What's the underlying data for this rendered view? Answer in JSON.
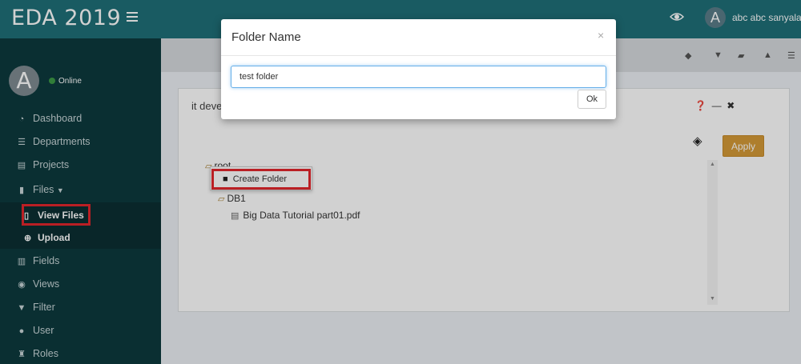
{
  "header": {
    "title": "EDA 2019",
    "username": "abc abc sanyala.",
    "avatar_letter": "A"
  },
  "sidebar": {
    "avatar_letter": "A",
    "status": "Online",
    "items": [
      {
        "label": "Dashboard",
        "icon": "dashboard-icon"
      },
      {
        "label": "Departments",
        "icon": "list-icon"
      },
      {
        "label": "Projects",
        "icon": "server-icon"
      },
      {
        "label": "Files",
        "icon": "file-icon"
      },
      {
        "label": "Fields",
        "icon": "list-alt-icon"
      },
      {
        "label": "Views",
        "icon": "view-icon"
      },
      {
        "label": "Filter",
        "icon": "filter-icon"
      },
      {
        "label": "User",
        "icon": "user-icon"
      },
      {
        "label": "Roles",
        "icon": "roles-icon"
      }
    ],
    "submenu": [
      {
        "label": "View Files",
        "icon": "file-icon"
      },
      {
        "label": "Upload",
        "icon": "upload-icon"
      }
    ]
  },
  "panel": {
    "title": "it deve",
    "apply_label": "Apply",
    "tree": [
      {
        "label": "root"
      },
      {
        "label": "DB1"
      },
      {
        "label": "Big Data Tutorial part01.pdf"
      }
    ],
    "context_menu": {
      "label": "Create Folder"
    }
  },
  "modal": {
    "title": "Folder Name",
    "close": "×",
    "input_value": "test folder",
    "ok_label": "Ok"
  },
  "colors": {
    "header": "#1f6f78",
    "sidebar": "#0d3a3e",
    "highlight": "#e3262d",
    "apply": "#d59a38"
  }
}
